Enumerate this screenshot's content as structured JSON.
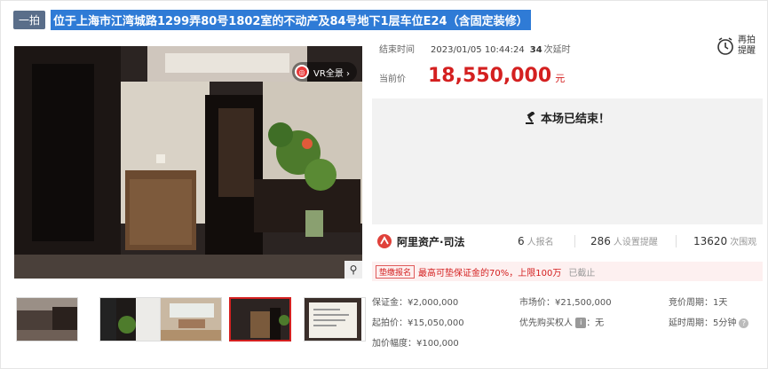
{
  "title": {
    "badge": "一拍",
    "text": "位于上海市江湾城路1299弄80号1802室的不动产及84号地下1层车位E24（含固定装修）"
  },
  "gallery": {
    "vr_label": "VR全景 ›",
    "vr_mark": "◎",
    "zoom_icon": "⚲",
    "thumbnails": [
      "living-room-1",
      "hallway-plants",
      "dining-room",
      "entry-cabinet",
      "document"
    ],
    "selected_index": 3
  },
  "auction": {
    "end_label": "结束时间",
    "end_time": "2023/01/05 10:44:24",
    "delay_count": "34",
    "delay_label": "次延时",
    "remind_label_1": "再拍",
    "remind_label_2": "提醒",
    "price_label": "当前价",
    "price_value": "18,550,000",
    "price_unit": "元",
    "ended_text": "本场已结束！"
  },
  "stats": {
    "brand": "阿里资产·司法",
    "signups": "6",
    "signups_label": "人报名",
    "reminders": "286",
    "reminders_label": "人设置提醒",
    "views": "13620",
    "views_label": "次围观"
  },
  "notice": {
    "tag": "垫缴报名",
    "message": "最高可垫保证金的70%，上限100万",
    "status": "已截止"
  },
  "details": {
    "deposit": "保证金：¥2,000,000",
    "market_price": "市场价：¥21,500,000",
    "bid_cycle": "竞价周期：1天",
    "start_price": "起拍价：¥15,050,000",
    "priority_label": "优先购买权人",
    "priority_badge": "i",
    "priority_value": "：无",
    "delay_cycle": "延时周期：5分钟",
    "help_mark": "?",
    "increment": "加价幅度：¥100,000"
  },
  "colors": {
    "accent": "#d42020",
    "title_highlight": "#2f7bd6",
    "badge_bg": "#5a6e8a",
    "ended_bg": "#f2f2f2"
  }
}
